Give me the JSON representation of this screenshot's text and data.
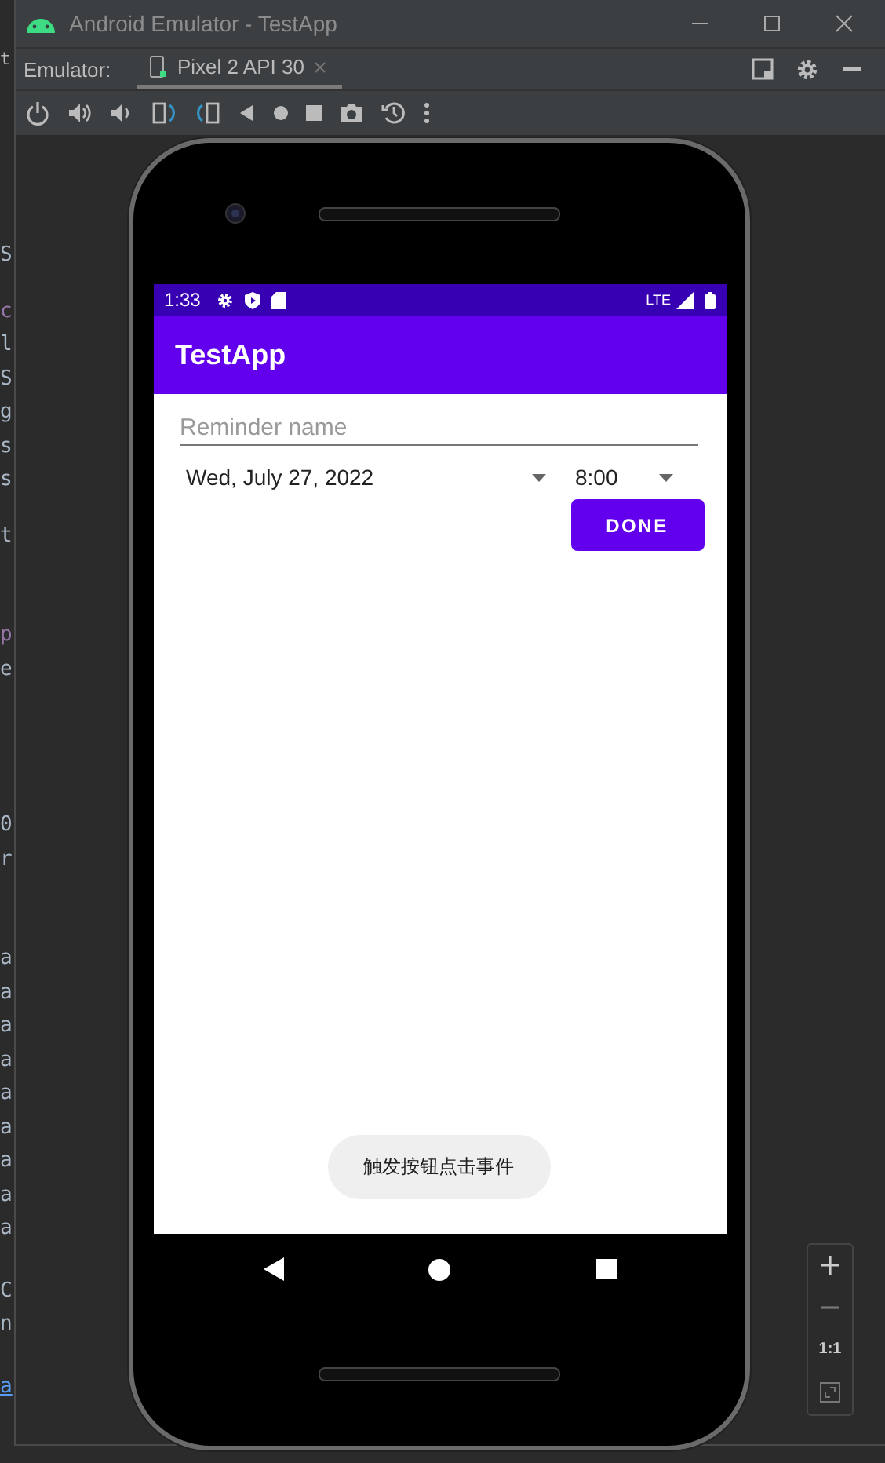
{
  "window": {
    "title": "Android Emulator - TestApp"
  },
  "toolbar": {
    "label": "Emulator:",
    "device_tab": {
      "label": "Pixel 2 API 30",
      "selected": true
    }
  },
  "background_editor": {
    "top_fragment": "t",
    "line_fragments": [
      {
        "text": "S",
        "kind": "plain"
      },
      {
        "text": "c",
        "kind": "keyword"
      },
      {
        "text": "l",
        "kind": "plain"
      },
      {
        "text": "S",
        "kind": "plain"
      },
      {
        "text": "g",
        "kind": "plain"
      },
      {
        "text": "s",
        "kind": "plain"
      },
      {
        "text": "s",
        "kind": "plain"
      },
      {
        "text": "t",
        "kind": "plain"
      },
      {
        "text": "p",
        "kind": "keyword"
      },
      {
        "text": "e",
        "kind": "plain"
      },
      {
        "text": "0",
        "kind": "plain"
      },
      {
        "text": "r",
        "kind": "plain"
      },
      {
        "text": "a",
        "kind": "plain"
      },
      {
        "text": "a",
        "kind": "plain"
      },
      {
        "text": "a",
        "kind": "plain"
      },
      {
        "text": "a",
        "kind": "plain"
      },
      {
        "text": "a",
        "kind": "plain"
      },
      {
        "text": "a",
        "kind": "plain"
      },
      {
        "text": "a",
        "kind": "plain"
      },
      {
        "text": "a",
        "kind": "plain"
      },
      {
        "text": "a",
        "kind": "plain"
      },
      {
        "text": "C",
        "kind": "plain"
      },
      {
        "text": "n",
        "kind": "plain"
      },
      {
        "text": "a",
        "kind": "link"
      }
    ]
  },
  "status_bar": {
    "time": "1:33",
    "network": "LTE"
  },
  "app_bar": {
    "title": "TestApp"
  },
  "form": {
    "name_field": {
      "placeholder": "Reminder name"
    },
    "date_spinner": {
      "value": "Wed, July 27, 2022"
    },
    "time_spinner": {
      "value": "8:00"
    },
    "done_button": {
      "label": "DONE"
    }
  },
  "toast": {
    "text": "触发按钮点击事件"
  },
  "zoom_controls": {
    "actual_size": "1:1"
  }
}
